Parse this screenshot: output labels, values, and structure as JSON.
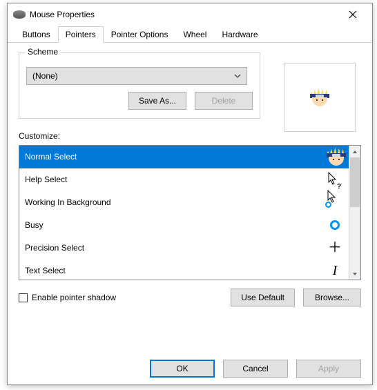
{
  "titlebar": {
    "title": "Mouse Properties"
  },
  "tabs": {
    "buttons": "Buttons",
    "pointers": "Pointers",
    "pointer_options": "Pointer Options",
    "wheel": "Wheel",
    "hardware": "Hardware"
  },
  "scheme": {
    "legend": "Scheme",
    "value": "(None)",
    "save_as": "Save As...",
    "delete": "Delete"
  },
  "customize": {
    "label": "Customize:",
    "items": [
      {
        "label": "Normal Select",
        "icon": "naruto",
        "selected": true
      },
      {
        "label": "Help Select",
        "icon": "arrow-help",
        "selected": false
      },
      {
        "label": "Working In Background",
        "icon": "arrow-ring",
        "selected": false
      },
      {
        "label": "Busy",
        "icon": "ring",
        "selected": false
      },
      {
        "label": "Precision Select",
        "icon": "plus",
        "selected": false
      },
      {
        "label": "Text Select",
        "icon": "ibeam",
        "selected": false
      }
    ]
  },
  "checkbox": {
    "label": "Enable pointer shadow",
    "checked": false
  },
  "actions": {
    "use_default": "Use Default",
    "browse": "Browse..."
  },
  "footer": {
    "ok": "OK",
    "cancel": "Cancel",
    "apply": "Apply"
  }
}
